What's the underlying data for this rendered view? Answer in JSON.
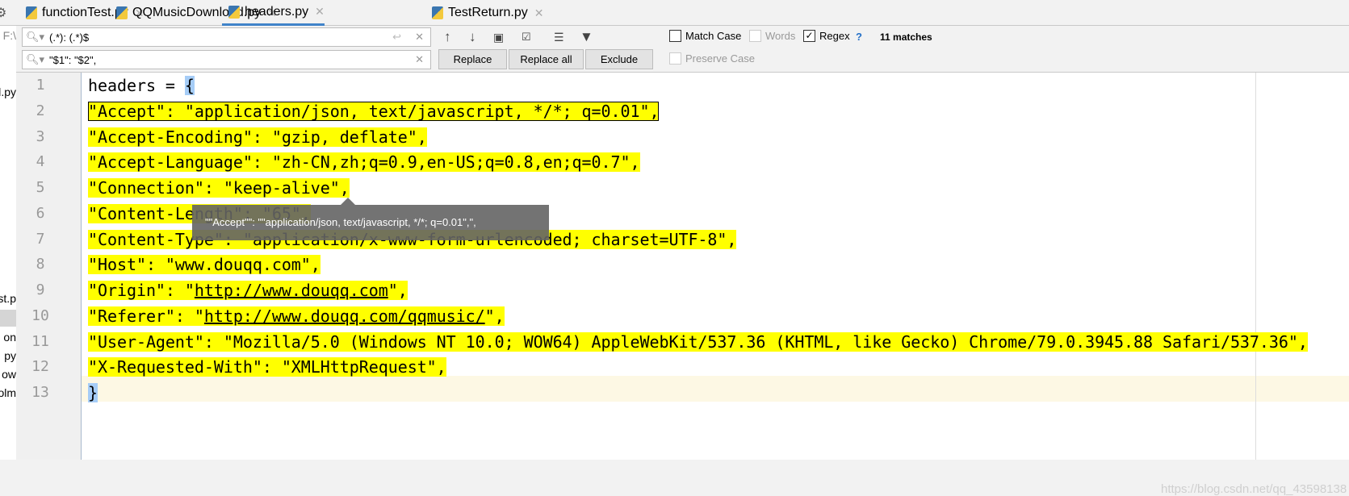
{
  "tabs": [
    {
      "label": "functionTest.py",
      "active": false
    },
    {
      "label": "QQMusicDownload.py",
      "active": false
    },
    {
      "label": "headers.py",
      "active": true
    },
    {
      "label": "TestReturn.py",
      "active": false
    }
  ],
  "project_panel": {
    "items": [
      "F:\\",
      "d.py",
      "st.p",
      "on",
      "py",
      "ow",
      "olm"
    ]
  },
  "find": {
    "search_value": "(.*): (.*)$",
    "replace_value": "\"$1\": \"$2\",",
    "replace_label": "Replace",
    "replace_all_label": "Replace all",
    "exclude_label": "Exclude",
    "match_case_label": "Match Case",
    "words_label": "Words",
    "regex_label": "Regex",
    "help": "?",
    "preserve_case_label": "Preserve Case",
    "matches": "11 matches",
    "match_case": false,
    "words": false,
    "regex": true,
    "preserve_case": false
  },
  "editor": {
    "lines": [
      "headers = {",
      "\"Accept\": \"application/json, text/javascript, */*; q=0.01\",",
      "\"Accept-Encoding\": \"gzip, deflate\",",
      "\"Accept-Language\": \"zh-CN,zh;q=0.9,en-US;q=0.8,en;q=0.7\",",
      "\"Connection\": \"keep-alive\",",
      "\"Content-Length\": \"65\",",
      "\"Content-Type\": \"application/x-www-form-urlencoded; charset=UTF-8\",",
      "\"Host\": \"www.douqq.com\",",
      "\"Origin\": \"http://www.douqq.com\",",
      "\"Referer\": \"http://www.douqq.com/qqmusic/\",",
      "\"User-Agent\": \"Mozilla/5.0 (Windows NT 10.0; WOW64) AppleWebKit/537.36 (KHTML, like Gecko) Chrome/79.0.3945.88 Safari/537.36\",",
      "\"X-Requested-With\": \"XMLHttpRequest\",",
      "}"
    ],
    "highlight_color": "#ffff00",
    "tooltip": "\"\"Accept\"\": \"\"application/json, text/javascript, */*; q=0.01\",\","
  },
  "watermark": "https://blog.csdn.net/qq_43598138"
}
